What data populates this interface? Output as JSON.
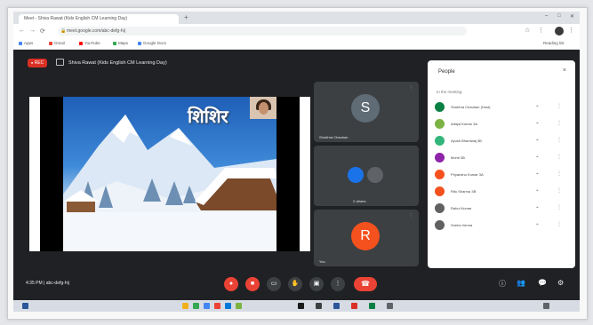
{
  "browser": {
    "tab_title": "Meet - Shiva Rawat (Kids English CM Learning Day)",
    "new_tab": "+",
    "address": "meet.google.com/abc-defg-hij",
    "profile_initial": "",
    "bookmarks": [
      "Apps",
      "Gmail",
      "YouTube",
      "Maps",
      "Google Docs",
      "Reading list"
    ]
  },
  "meet": {
    "rec_label": "REC",
    "meeting_title": "Shiva Rawat (Kids English CM Learning Day)",
    "slide_text": "शिशिर",
    "tiles": [
      {
        "initial": "S",
        "name": "Shubhra Chauhan",
        "color": "#5f6b75"
      },
      {
        "initial": "",
        "name": "2 others",
        "color": "#1a73e8"
      },
      {
        "initial": "R",
        "name": "You",
        "color": "#f4511e"
      }
    ],
    "bottom_time": "4:35 PM  |  abc-defg-hij",
    "end_icon": "phone-hangup-icon"
  },
  "people": {
    "title": "People",
    "close": "×",
    "section": "In the meeting",
    "participants": [
      {
        "name": "Shubhra Chauhan (Host)",
        "color": "#0b8043"
      },
      {
        "name": "Aditya Kumar 3A",
        "color": "#7cb342"
      },
      {
        "name": "Ayush Bhardwaj 3B",
        "color": "#33b679"
      },
      {
        "name": "Mohit 3B",
        "color": "#8e24aa"
      },
      {
        "name": "Priyanshu Kumar 3A",
        "color": "#f4511e"
      },
      {
        "name": "Ritu Sharma 3B",
        "color": "#f4511e"
      },
      {
        "name": "Rahul Kumar",
        "color": "#616161"
      },
      {
        "name": "Sneha Verma",
        "color": "#616161"
      }
    ]
  }
}
